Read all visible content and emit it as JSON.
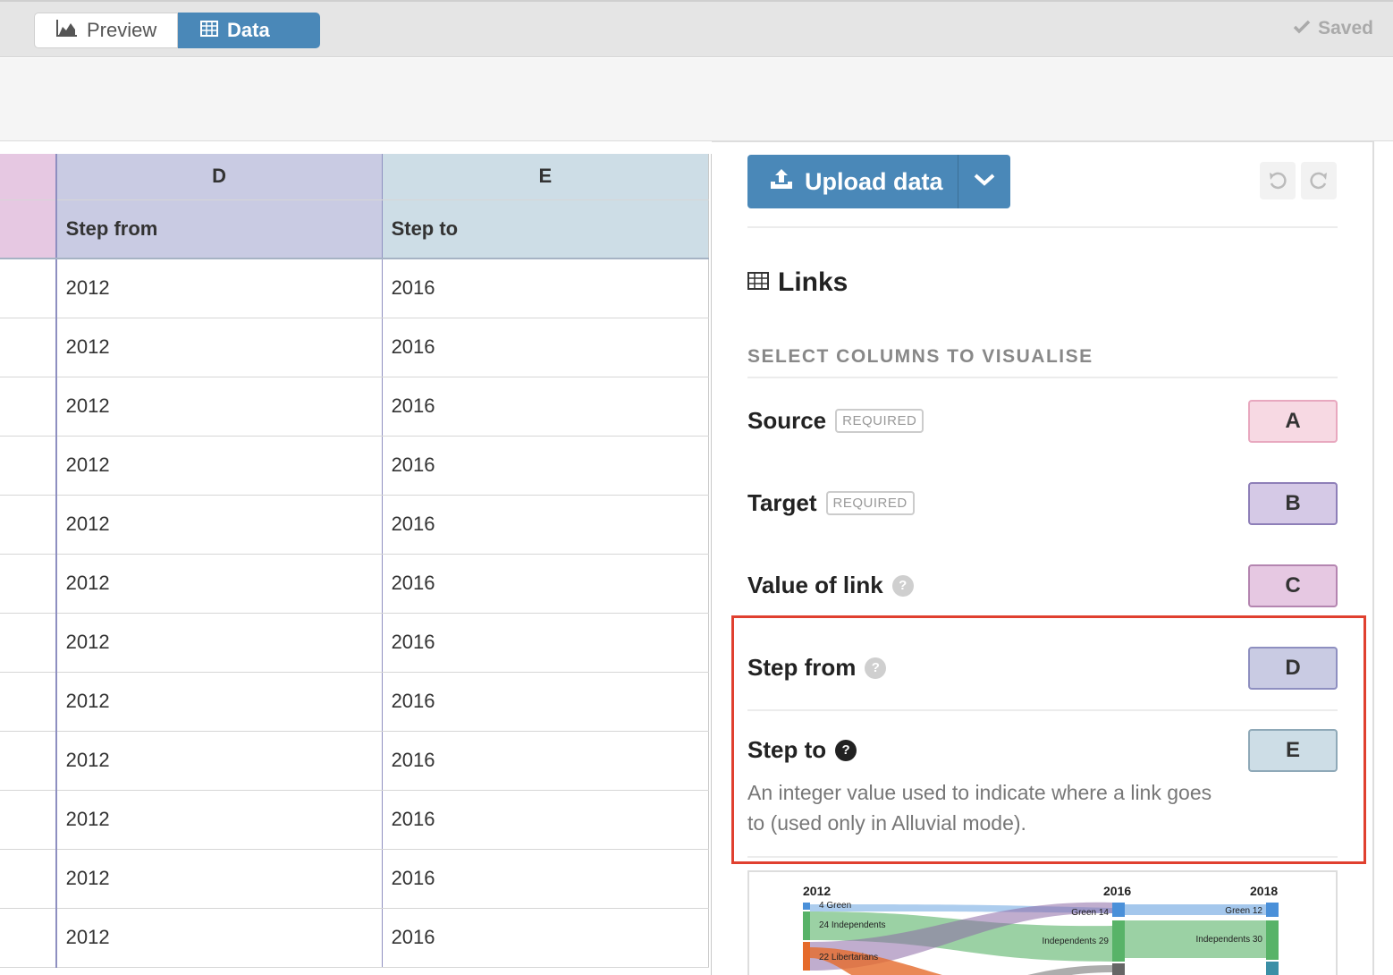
{
  "topbar": {
    "preview_tab": "Preview",
    "data_tab": "Data",
    "saved_label": "Saved",
    "preview_icon": "area-chart-icon",
    "data_icon": "table-icon",
    "saved_icon": "check-icon"
  },
  "grid": {
    "col_letters": [
      "D",
      "E"
    ],
    "headers": [
      "Step from",
      "Step to"
    ],
    "rows": [
      [
        "2012",
        "2016"
      ],
      [
        "2012",
        "2016"
      ],
      [
        "2012",
        "2016"
      ],
      [
        "2012",
        "2016"
      ],
      [
        "2012",
        "2016"
      ],
      [
        "2012",
        "2016"
      ],
      [
        "2012",
        "2016"
      ],
      [
        "2012",
        "2016"
      ],
      [
        "2012",
        "2016"
      ],
      [
        "2012",
        "2016"
      ],
      [
        "2012",
        "2016"
      ],
      [
        "2012",
        "2016"
      ]
    ]
  },
  "panel": {
    "upload_label": "Upload data",
    "section_title": "Links",
    "select_label": "SELECT COLUMNS TO VISUALISE",
    "bindings": [
      {
        "label": "Source",
        "badge": "REQUIRED",
        "column": "A",
        "color": "#f7d9e3",
        "border": "#e8a8bf"
      },
      {
        "label": "Target",
        "badge": "REQUIRED",
        "column": "B",
        "color": "#d5c9e6",
        "border": "#8e7fb8"
      },
      {
        "label": "Value of link",
        "help": "?",
        "column": "C",
        "color": "#e6c8e2",
        "border": "#b485b0"
      },
      {
        "label": "Step from",
        "help": "?",
        "column": "D",
        "color": "#c9cbe3",
        "border": "#8e8fc0"
      },
      {
        "label": "Step to",
        "help": "?",
        "column": "E",
        "color": "#cddde6",
        "border": "#8fa9b8"
      }
    ],
    "step_to_description": "An integer value used to indicate where a link goes to (used only in Alluvial mode)."
  },
  "thumbnail": {
    "years": [
      "2012",
      "2016",
      "2018"
    ],
    "labels": [
      "4 Green",
      "24 Independents",
      "22 Libertarians",
      "Green 14",
      "Independents 29",
      "Green 12",
      "Independents 30"
    ]
  }
}
